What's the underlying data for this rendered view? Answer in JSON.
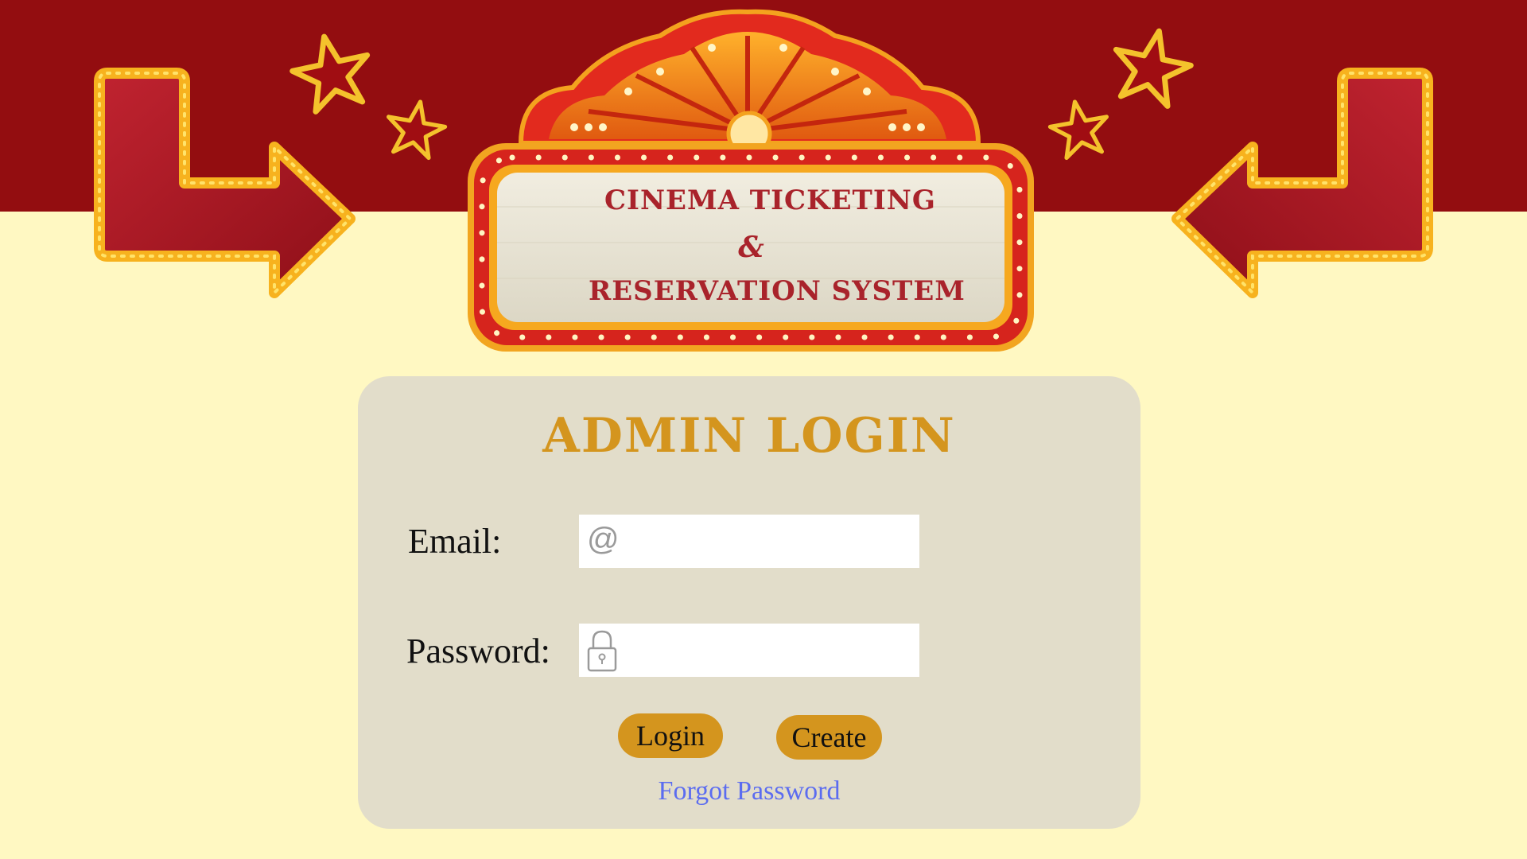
{
  "header": {
    "line1": "CINEMA TICKETING",
    "line2": "&",
    "line3": "RESERVATION SYSTEM"
  },
  "login": {
    "title": "ADMIN LOGIN",
    "email_label": "Email:",
    "email_value": "",
    "email_icon": "at-icon",
    "password_label": "Password:",
    "password_value": "",
    "password_icon": "lock-icon",
    "login_label": "Login",
    "create_label": "Create",
    "forgot_label": "Forgot Password"
  },
  "colors": {
    "top_band": "#930d10",
    "page_bg": "#fff8c2",
    "card_bg": "#e2ddca",
    "accent_gold": "#d4951e",
    "title_red": "#a9232b",
    "link_blue": "#5b6cf0"
  }
}
